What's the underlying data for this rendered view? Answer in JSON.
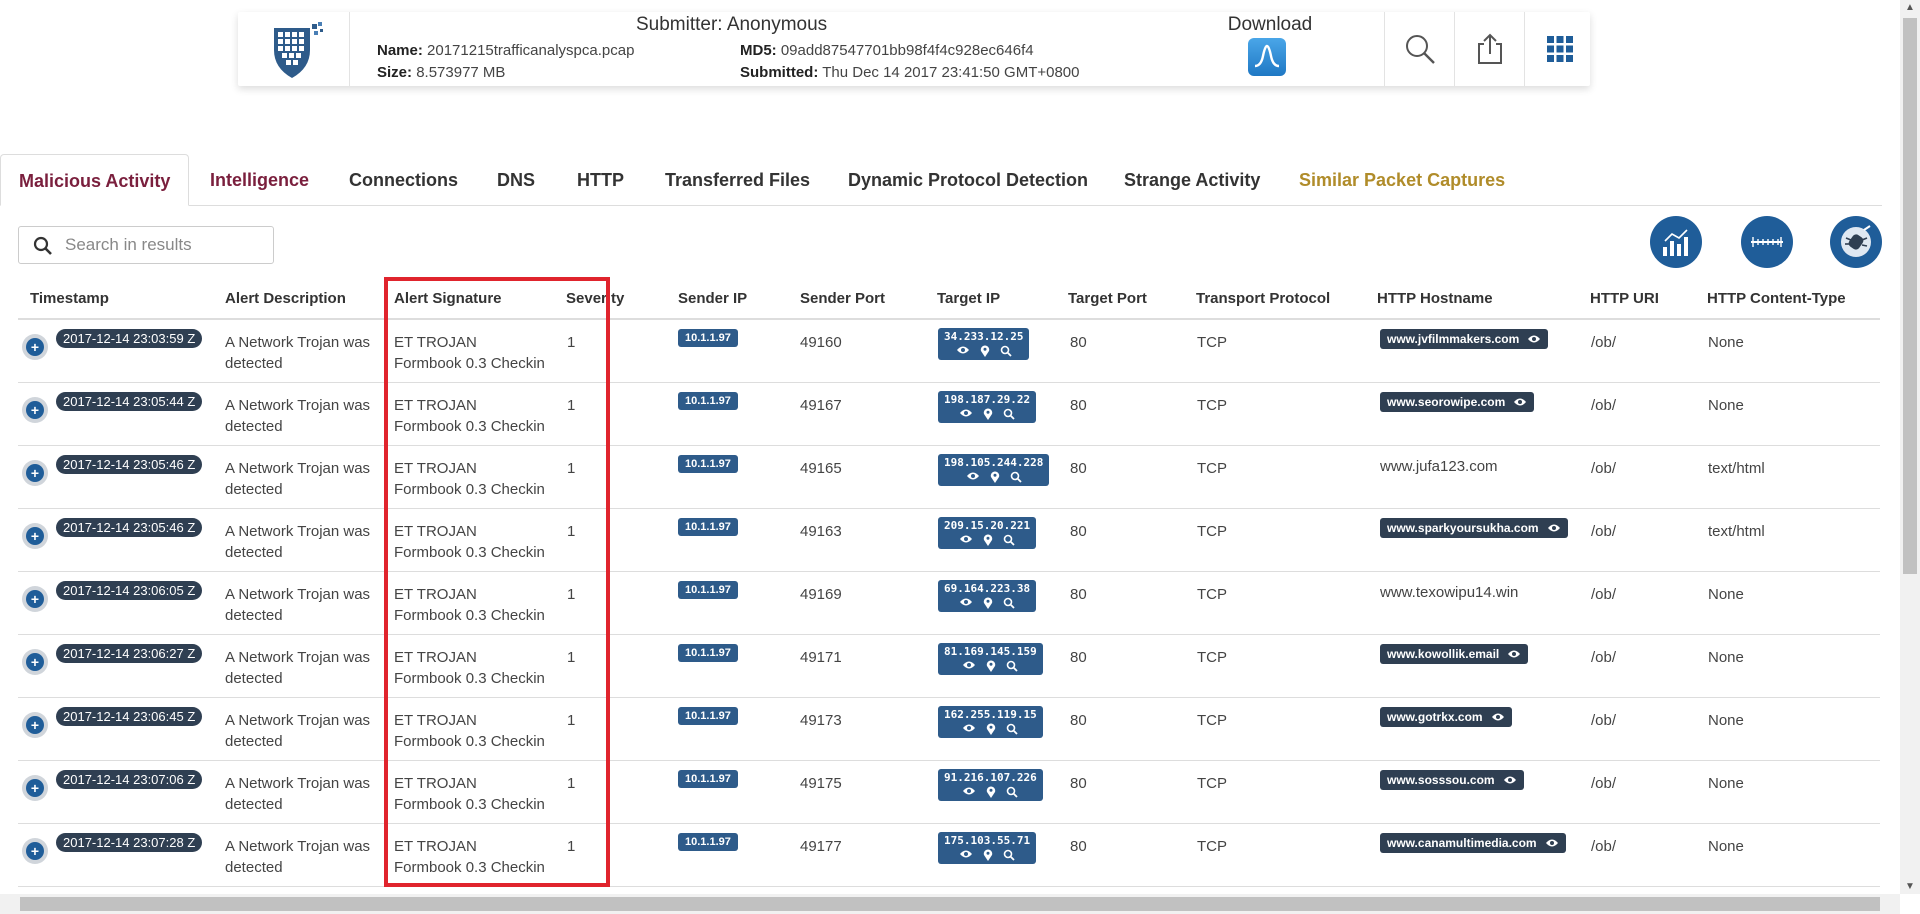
{
  "header": {
    "submitter": "Submitter: Anonymous",
    "name_label": "Name:",
    "name_value": "20171215trafficanalyspca.pcap",
    "size_label": "Size:",
    "size_value": "8.573977 MB",
    "md5_label": "MD5:",
    "md5_value": "09add87547701bb98f4f4c928ec646f4",
    "submitted_label": "Submitted:",
    "submitted_value": "Thu Dec 14 2017 23:41:50 GMT+0800",
    "download_label": "Download",
    "icons": [
      "logo-shield",
      "download-wave-icon",
      "search-icon",
      "share-icon",
      "apps-grid-icon"
    ]
  },
  "tabs": [
    {
      "label": "Malicious Activity",
      "active": true
    },
    {
      "label": "Intelligence"
    },
    {
      "label": "Connections"
    },
    {
      "label": "DNS"
    },
    {
      "label": "HTTP"
    },
    {
      "label": "Transferred Files"
    },
    {
      "label": "Dynamic Protocol Detection"
    },
    {
      "label": "Strange Activity"
    },
    {
      "label": "Similar Packet Captures"
    }
  ],
  "search": {
    "placeholder": "Search in results"
  },
  "columns": [
    "Timestamp",
    "Alert Description",
    "Alert Signature",
    "Severity",
    "Sender IP",
    "Sender Port",
    "Target IP",
    "Target Port",
    "Transport Protocol",
    "HTTP Hostname",
    "HTTP URI",
    "HTTP Content-Type"
  ],
  "rows": [
    {
      "timestamp": "2017-12-14 23:03:59 Z",
      "desc1": "A Network Trojan was",
      "desc2": "detected",
      "sig1": "ET TROJAN",
      "sig2": "Formbook 0.3 Checkin",
      "severity": "1",
      "sender_ip": "10.1.1.97",
      "sender_port": "49160",
      "target_ip": "34.233.12.25",
      "target_port": "80",
      "protocol": "TCP",
      "hostname": "www.jvfilmmakers.com",
      "host_badge": true,
      "uri": "/ob/",
      "content_type": "None"
    },
    {
      "timestamp": "2017-12-14 23:05:44 Z",
      "desc1": "A Network Trojan was",
      "desc2": "detected",
      "sig1": "ET TROJAN",
      "sig2": "Formbook 0.3 Checkin",
      "severity": "1",
      "sender_ip": "10.1.1.97",
      "sender_port": "49167",
      "target_ip": "198.187.29.22",
      "target_port": "80",
      "protocol": "TCP",
      "hostname": "www.seorowipe.com",
      "host_badge": true,
      "uri": "/ob/",
      "content_type": "None"
    },
    {
      "timestamp": "2017-12-14 23:05:46 Z",
      "desc1": "A Network Trojan was",
      "desc2": "detected",
      "sig1": "ET TROJAN",
      "sig2": "Formbook 0.3 Checkin",
      "severity": "1",
      "sender_ip": "10.1.1.97",
      "sender_port": "49165",
      "target_ip": "198.105.244.228",
      "target_port": "80",
      "protocol": "TCP",
      "hostname": "www.jufa123.com",
      "host_badge": false,
      "uri": "/ob/",
      "content_type": "text/html"
    },
    {
      "timestamp": "2017-12-14 23:05:46 Z",
      "desc1": "A Network Trojan was",
      "desc2": "detected",
      "sig1": "ET TROJAN",
      "sig2": "Formbook 0.3 Checkin",
      "severity": "1",
      "sender_ip": "10.1.1.97",
      "sender_port": "49163",
      "target_ip": "209.15.20.221",
      "target_port": "80",
      "protocol": "TCP",
      "hostname": "www.sparkyoursukha.com",
      "host_badge": true,
      "uri": "/ob/",
      "content_type": "text/html"
    },
    {
      "timestamp": "2017-12-14 23:06:05 Z",
      "desc1": "A Network Trojan was",
      "desc2": "detected",
      "sig1": "ET TROJAN",
      "sig2": "Formbook 0.3 Checkin",
      "severity": "1",
      "sender_ip": "10.1.1.97",
      "sender_port": "49169",
      "target_ip": "69.164.223.38",
      "target_port": "80",
      "protocol": "TCP",
      "hostname": "www.texowipu14.win",
      "host_badge": false,
      "uri": "/ob/",
      "content_type": "None"
    },
    {
      "timestamp": "2017-12-14 23:06:27 Z",
      "desc1": "A Network Trojan was",
      "desc2": "detected",
      "sig1": "ET TROJAN",
      "sig2": "Formbook 0.3 Checkin",
      "severity": "1",
      "sender_ip": "10.1.1.97",
      "sender_port": "49171",
      "target_ip": "81.169.145.159",
      "target_port": "80",
      "protocol": "TCP",
      "hostname": "www.kowollik.email",
      "host_badge": true,
      "uri": "/ob/",
      "content_type": "None"
    },
    {
      "timestamp": "2017-12-14 23:06:45 Z",
      "desc1": "A Network Trojan was",
      "desc2": "detected",
      "sig1": "ET TROJAN",
      "sig2": "Formbook 0.3 Checkin",
      "severity": "1",
      "sender_ip": "10.1.1.97",
      "sender_port": "49173",
      "target_ip": "162.255.119.15",
      "target_port": "80",
      "protocol": "TCP",
      "hostname": "www.gotrkx.com",
      "host_badge": true,
      "uri": "/ob/",
      "content_type": "None"
    },
    {
      "timestamp": "2017-12-14 23:07:06 Z",
      "desc1": "A Network Trojan was",
      "desc2": "detected",
      "sig1": "ET TROJAN",
      "sig2": "Formbook 0.3 Checkin",
      "severity": "1",
      "sender_ip": "10.1.1.97",
      "sender_port": "49175",
      "target_ip": "91.216.107.226",
      "target_port": "80",
      "protocol": "TCP",
      "hostname": "www.sosssou.com",
      "host_badge": true,
      "uri": "/ob/",
      "content_type": "None"
    },
    {
      "timestamp": "2017-12-14 23:07:28 Z",
      "desc1": "A Network Trojan was",
      "desc2": "detected",
      "sig1": "ET TROJAN",
      "sig2": "Formbook 0.3 Checkin",
      "severity": "1",
      "sender_ip": "10.1.1.97",
      "sender_port": "49177",
      "target_ip": "175.103.55.71",
      "target_port": "80",
      "protocol": "TCP",
      "hostname": "www.canamultimedia.com",
      "host_badge": true,
      "uri": "/ob/",
      "content_type": "None"
    }
  ],
  "colors": {
    "accent": "#1f5d99",
    "badge_dark": "#2f3f52",
    "active_tab": "#7a1f3d",
    "similar_tab": "#b08c2a",
    "highlight": "#e0242d"
  }
}
